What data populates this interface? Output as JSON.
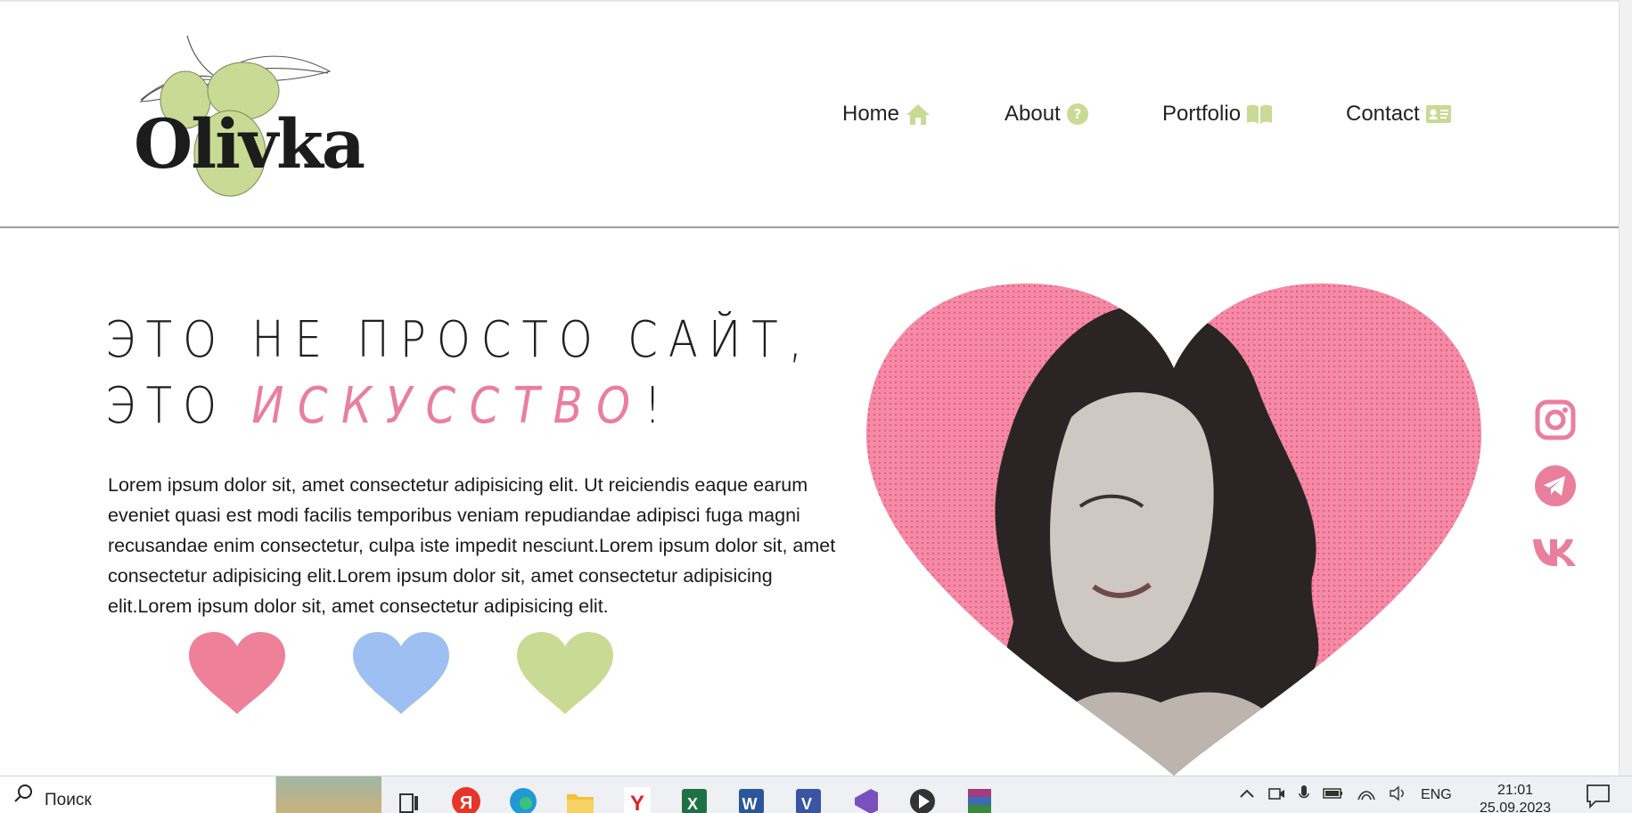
{
  "header": {
    "logo_text": "Olivka",
    "nav": [
      {
        "label": "Home",
        "icon": "home-icon"
      },
      {
        "label": "About",
        "icon": "question-icon"
      },
      {
        "label": "Portfolio",
        "icon": "book-icon"
      },
      {
        "label": "Contact",
        "icon": "contact-card-icon"
      }
    ]
  },
  "hero": {
    "title_line1": "ЭТО НЕ ПРОСТО САЙТ,",
    "title_line2_prefix": "ЭТО ",
    "title_line2_accent": "ИСКУССТВО",
    "title_line2_suffix": "!",
    "body": "Lorem ipsum dolor sit, amet consectetur adipisicing elit. Ut reiciendis eaque earum eveniet quasi est modi facilis temporibus veniam repudiandae adipisci fuga magni recusandae enim consectetur, culpa iste impedit nesciunt.Lorem ipsum dolor sit, amet consectetur adipisicing elit.Lorem ipsum dolor sit, amet consectetur adipisicing elit.Lorem ipsum dolor sit, amet consectetur adipisicing elit.",
    "hearts": [
      {
        "name": "pink",
        "color": "#ee8099"
      },
      {
        "name": "blue",
        "color": "#9dbff2"
      },
      {
        "name": "green",
        "color": "#c9da94"
      }
    ]
  },
  "social": [
    "instagram-icon",
    "telegram-icon",
    "vk-icon"
  ],
  "colors": {
    "accent_pink": "#ea7e9d",
    "olive_green": "#c9da94",
    "heart_photo_bg": "#f48aa5"
  },
  "taskbar": {
    "search_text": "Поиск",
    "apps": [
      "yandex-icon",
      "edge-icon",
      "file-explorer-icon",
      "yandex-browser-icon",
      "excel-icon",
      "word-icon",
      "visio-icon",
      "visual-studio-icon",
      "media-player-icon",
      "winrar-icon"
    ],
    "lang": "ENG",
    "time": "21:01",
    "date": "25.09.2023"
  }
}
